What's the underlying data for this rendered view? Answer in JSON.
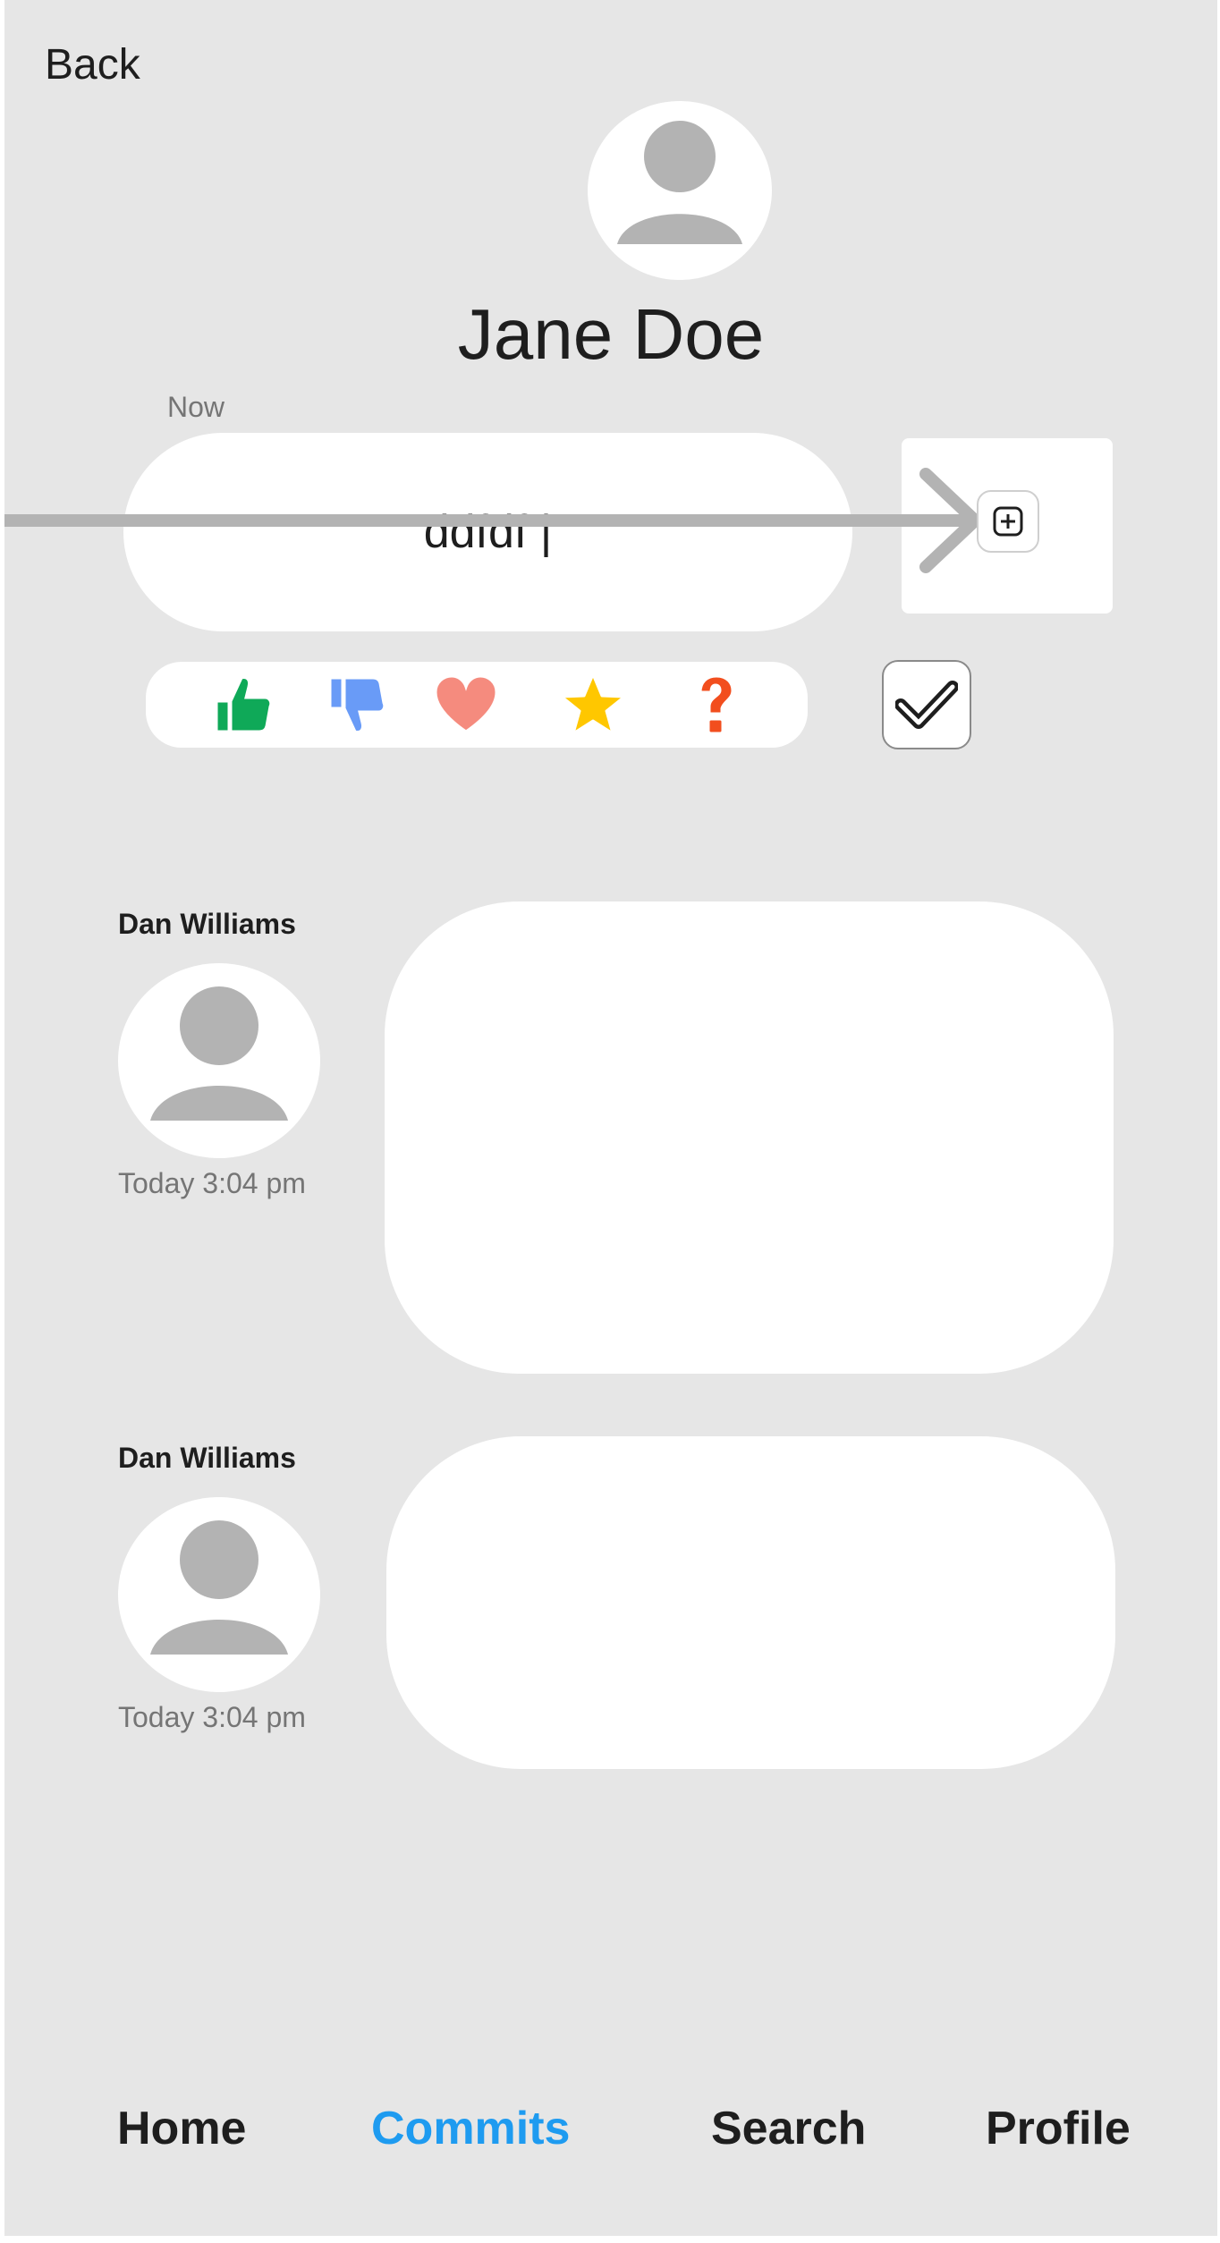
{
  "header": {
    "back_label": "Back"
  },
  "profile": {
    "name": "Jane Doe",
    "avatar_icon": "user-avatar-icon"
  },
  "composer": {
    "time_label": "Now",
    "input_value": "ddfdf |",
    "attach_icon": "plus-square-icon",
    "confirm_icon": "checkmark-icon"
  },
  "reactions": [
    {
      "name": "thumbs-up",
      "icon": "thumbs-up-icon",
      "color": "#0fa958"
    },
    {
      "name": "thumbs-down",
      "icon": "thumbs-down-icon",
      "color": "#699bf7"
    },
    {
      "name": "heart",
      "icon": "heart-icon",
      "color": "#f58b7e"
    },
    {
      "name": "star",
      "icon": "star-icon",
      "color": "#ffc700"
    },
    {
      "name": "question",
      "icon": "question-mark-icon",
      "color": "#f24e1e"
    }
  ],
  "comments": [
    {
      "author": "Dan Williams",
      "time": "Today 3:04 pm"
    },
    {
      "author": "Dan Williams",
      "time": "Today 3:04 pm"
    }
  ],
  "nav": {
    "items": [
      {
        "label": "Home",
        "active": false
      },
      {
        "label": "Commits",
        "active": true
      },
      {
        "label": "Search",
        "active": false
      },
      {
        "label": "Profile",
        "active": false
      }
    ],
    "active_color": "#1e9bf0"
  },
  "colors": {
    "background": "#e6e6e6",
    "surface": "#ffffff",
    "text": "#1e1e1e",
    "muted": "#757575",
    "placeholder_avatar": "#b3b3b3"
  }
}
